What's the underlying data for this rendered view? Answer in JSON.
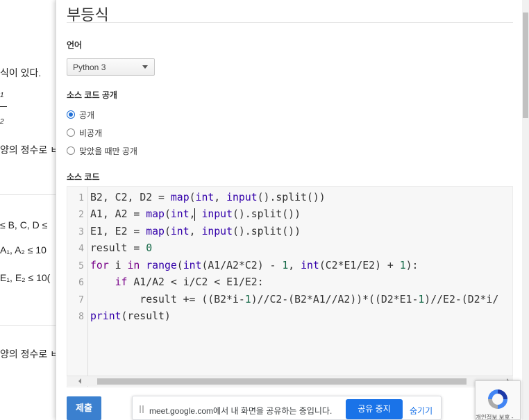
{
  "background_page": {
    "fragments": [
      "식이 있다.",
      "양의 정수로 ㅂ",
      "≤ B, C, D ≤",
      "A₁, A₂ ≤ 10",
      "E₁, E₂ ≤ 10(",
      "양의 정수로 ㅂ"
    ],
    "frac_top": "1",
    "frac_bottom": "2"
  },
  "modal": {
    "title": "부등식",
    "language": {
      "label": "언어",
      "selected": "Python 3"
    },
    "visibility": {
      "label": "소스 코드 공개",
      "options": [
        {
          "label": "공개",
          "checked": true
        },
        {
          "label": "비공개",
          "checked": false
        },
        {
          "label": "맞았을 때만 공개",
          "checked": false
        }
      ]
    },
    "source": {
      "label": "소스 코드",
      "line_numbers": [
        "1",
        "2",
        "3",
        "4",
        "5",
        "6",
        "7",
        "8"
      ],
      "lines": [
        "B2, C2, D2 = map(int, input().split())",
        "A1, A2 = map(int, input().split())",
        "E1, E2 = map(int, input().split())",
        "result = 0",
        "for i in range(int(A1/A2*C2) - 1, int(C2*E1/E2) + 1):",
        "    if A1/A2 < i/C2 < E1/E2:",
        "        result += ((B2*i-1)//C2-(B2*A1//A2))*((D2*E1-1)//E2-(D2*i/",
        "print(result)"
      ]
    },
    "submit_label": "제출"
  },
  "meet_bar": {
    "message": "meet.google.com에서 내 화면을 공유하는 중입니다.",
    "stop_label": "공유 중지",
    "hide_label": "숨기기"
  },
  "recaptcha": {
    "privacy_text": "개인정보 보호 -"
  },
  "colors": {
    "accent": "#3b80cf",
    "meet_blue": "#1a73e8",
    "keyword": "#770088",
    "builtin": "#3300aa",
    "number": "#116644"
  }
}
